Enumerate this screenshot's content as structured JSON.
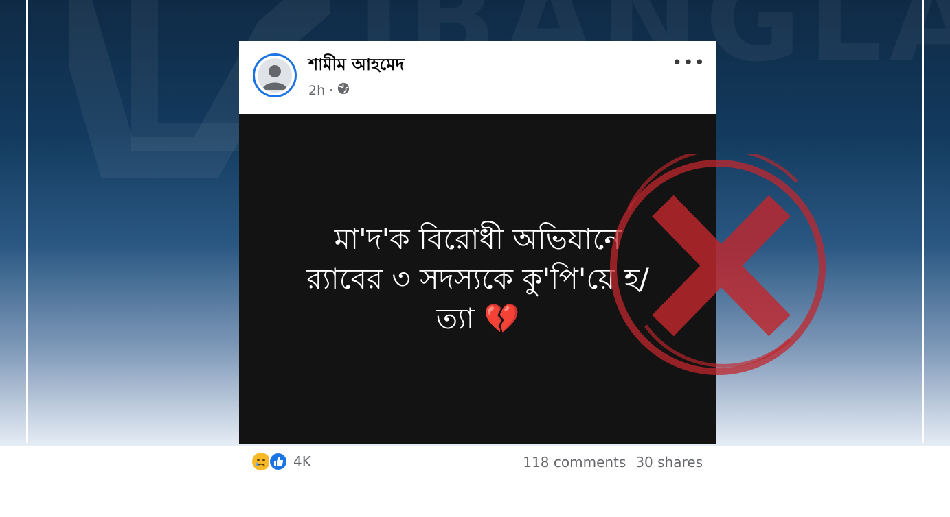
{
  "watermark": {
    "text": "IBANGLA"
  },
  "post": {
    "author": "শামীম আহমেদ",
    "time": "2h",
    "separator": "·",
    "privacy_icon": "globe-icon",
    "more_icon": "more-options-icon",
    "more_label": "•••",
    "body_lines": [
      "মা'দ'ক বিরোধী অভিযানে",
      "র‍্যাবের ৩ সদস্যকে কু'পি'য়ে হ/",
      "ত্যা 💔"
    ]
  },
  "footer": {
    "reaction_icons": [
      "sad-reaction-icon",
      "like-reaction-icon"
    ],
    "reaction_count": "4K",
    "comments": "118 comments",
    "shares": "30 shares"
  },
  "colors": {
    "accent": "#1b74e4",
    "stamp": "#c0272d",
    "post_bg": "#131313",
    "bg_top": "#0f2a45"
  }
}
